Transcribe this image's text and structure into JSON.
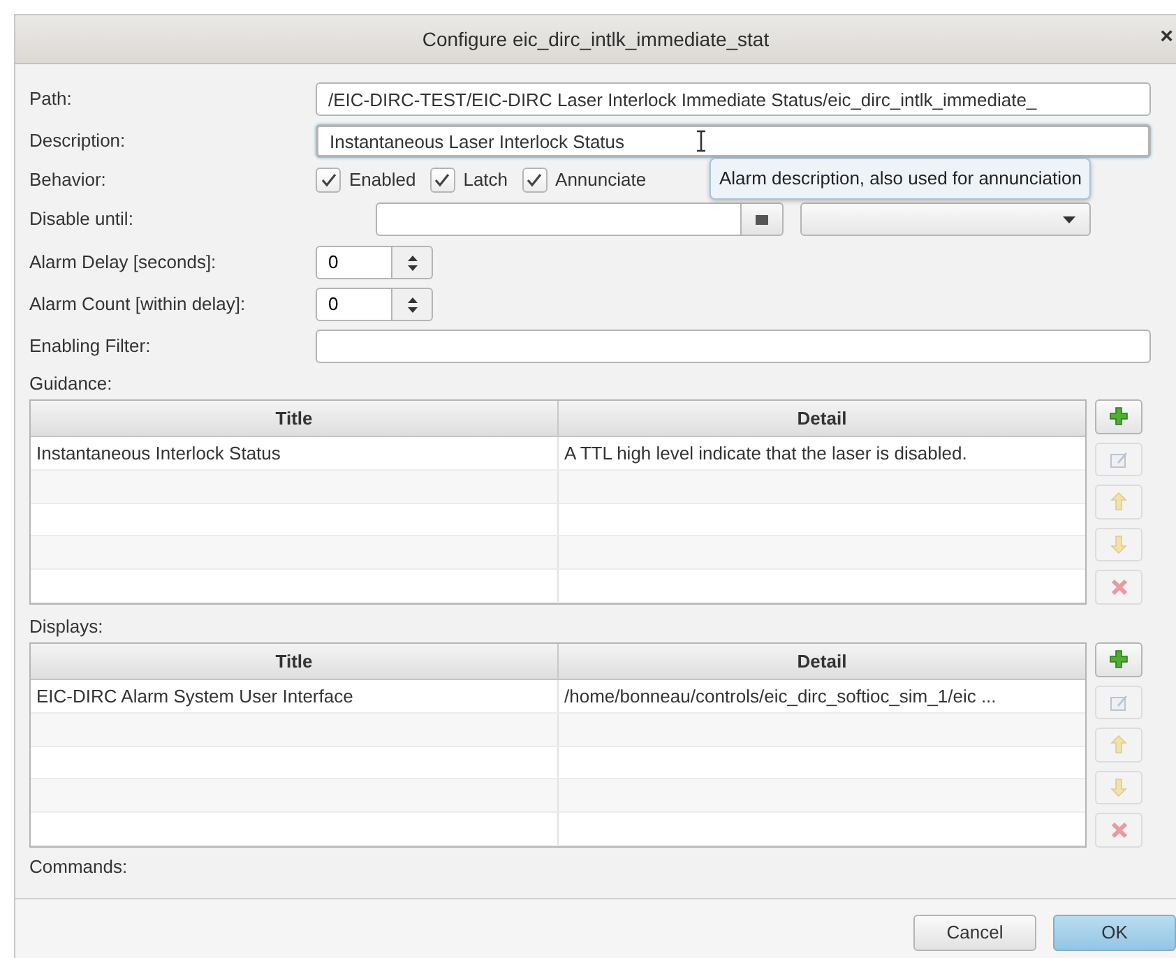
{
  "window": {
    "title": "Configure eic_dirc_intlk_immediate_stat",
    "close": "×"
  },
  "path": {
    "label": "Path:",
    "value": "/EIC-DIRC-TEST/EIC-DIRC Laser Interlock Immediate Status/eic_dirc_intlk_immediate_"
  },
  "description": {
    "label": "Description:",
    "value": "Instantaneous Laser Interlock Status",
    "focused": true,
    "tooltip": "Alarm description, also used for annunciation"
  },
  "behavior": {
    "label": "Behavior:",
    "options": [
      {
        "label": "Enabled",
        "checked": true
      },
      {
        "label": "Latch",
        "checked": true
      },
      {
        "label": "Annunciate",
        "checked": true
      }
    ]
  },
  "disable_until": {
    "label": "Disable until:"
  },
  "alarm_delay": {
    "label": "Alarm Delay [seconds]:",
    "value": "0"
  },
  "alarm_count": {
    "label": "Alarm Count [within delay]:",
    "value": "0"
  },
  "enabling_filter": {
    "label": "Enabling Filter:"
  },
  "tables": [
    {
      "label": "Guidance:",
      "columns": [
        "Title",
        "Detail"
      ],
      "rows": [
        [
          "Instantaneous Interlock Status",
          "A TTL high level indicate that the laser is disabled."
        ]
      ],
      "actions": [
        {
          "kind": "add",
          "disabled": false
        },
        {
          "kind": "edit",
          "disabled": true
        },
        {
          "kind": "up",
          "disabled": true
        },
        {
          "kind": "down",
          "disabled": true
        },
        {
          "kind": "delete",
          "disabled": true
        }
      ]
    },
    {
      "label": "Displays:",
      "columns": [
        "Title",
        "Detail"
      ],
      "rows": [
        [
          "EIC-DIRC Alarm System User Interface",
          "/home/bonneau/controls/eic_dirc_softioc_sim_1/eic ..."
        ]
      ],
      "actions": [
        {
          "kind": "add",
          "disabled": false
        },
        {
          "kind": "edit",
          "disabled": true
        },
        {
          "kind": "up",
          "disabled": true
        },
        {
          "kind": "down",
          "disabled": true
        },
        {
          "kind": "delete",
          "disabled": true
        }
      ]
    }
  ],
  "commands": {
    "label": "Commands:"
  },
  "buttons": [
    {
      "label": "Cancel",
      "default": false
    },
    {
      "label": "OK",
      "default": true
    }
  ]
}
